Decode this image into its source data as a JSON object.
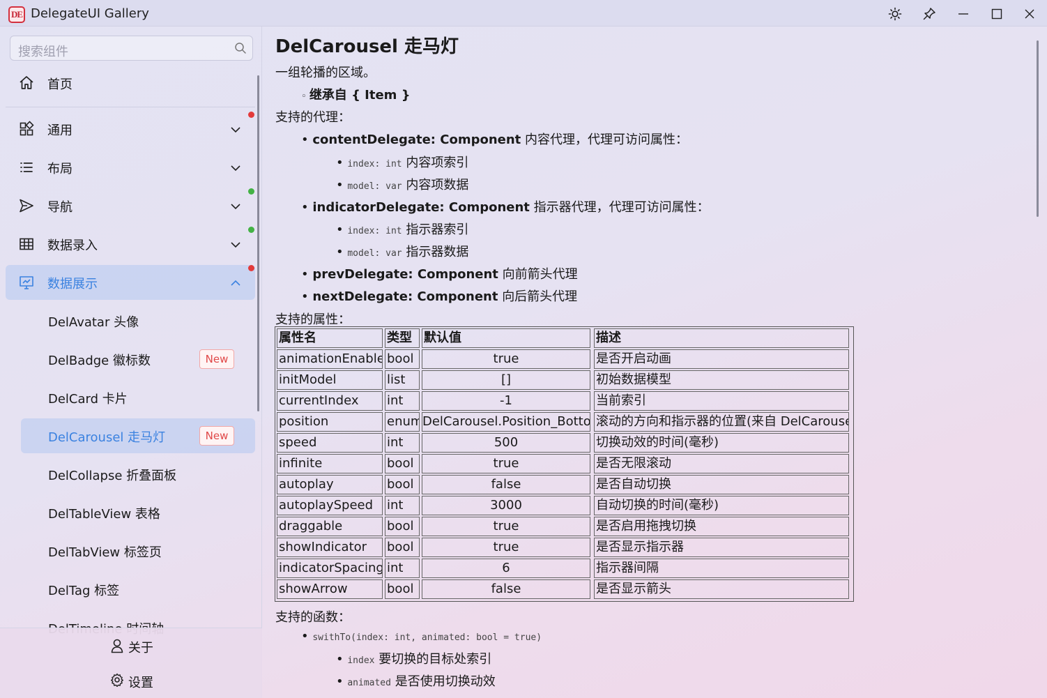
{
  "window": {
    "title": "DelegateUI Gallery",
    "logo_text": "DE"
  },
  "sidebar": {
    "search_placeholder": "搜索组件",
    "menu": [
      {
        "label": "首页",
        "icon": "home-icon"
      },
      {
        "label": "通用",
        "icon": "grid-icon"
      },
      {
        "label": "布局",
        "icon": "list-icon"
      },
      {
        "label": "导航",
        "icon": "send-icon"
      },
      {
        "label": "数据录入",
        "icon": "table-icon"
      },
      {
        "label": "数据展示",
        "icon": "presentation-icon"
      }
    ],
    "sub_items": [
      {
        "label": "DelAvatar 头像"
      },
      {
        "label": "DelBadge 徽标数",
        "badge": "New"
      },
      {
        "label": "DelCard 卡片"
      },
      {
        "label": "DelCarousel 走马灯",
        "badge": "New"
      },
      {
        "label": "DelCollapse 折叠面板"
      },
      {
        "label": "DelTableView 表格"
      },
      {
        "label": "DelTabView 标签页"
      },
      {
        "label": "DelTag 标签"
      },
      {
        "label": "DelTimeline 时间轴"
      }
    ],
    "footer": {
      "about": "关于",
      "settings": "设置"
    }
  },
  "doc": {
    "title": "DelCarousel 走马灯",
    "intro": "一组轮播的区域。",
    "inherits": "继承自 { Item }",
    "delegates_heading": "支持的代理：",
    "delegates": {
      "content": {
        "name": "contentDelegate: Component",
        "desc": "内容代理，代理可访问属性：",
        "p1_code": "index: int",
        "p1_desc": "内容项索引",
        "p2_code": "model: var",
        "p2_desc": "内容项数据"
      },
      "indicator": {
        "name": "indicatorDelegate: Component",
        "desc": "指示器代理，代理可访问属性：",
        "p1_code": "index: int",
        "p1_desc": "指示器索引",
        "p2_code": "model: var",
        "p2_desc": "指示器数据"
      },
      "prev": {
        "name": "prevDelegate: Component",
        "desc": "向前箭头代理"
      },
      "next": {
        "name": "nextDelegate: Component",
        "desc": "向后箭头代理"
      }
    },
    "props_heading": "支持的属性：",
    "table": {
      "headers": [
        "属性名",
        "类型",
        "默认值",
        "描述"
      ],
      "rows": [
        [
          "animationEnabled",
          "bool",
          "true",
          "是否开启动画"
        ],
        [
          "initModel",
          "list",
          "[]",
          "初始数据模型"
        ],
        [
          "currentIndex",
          "int",
          "-1",
          "当前索引"
        ],
        [
          "position",
          "enum",
          "DelCarousel.Position_Bottom",
          "滚动的方向和指示器的位置(来自 DelCarousel)"
        ],
        [
          "speed",
          "int",
          "500",
          "切换动效的时间(毫秒)"
        ],
        [
          "infinite",
          "bool",
          "true",
          "是否无限滚动"
        ],
        [
          "autoplay",
          "bool",
          "false",
          "是否自动切换"
        ],
        [
          "autoplaySpeed",
          "int",
          "3000",
          "自动切换的时间(毫秒)"
        ],
        [
          "draggable",
          "bool",
          "true",
          "是否启用拖拽切换"
        ],
        [
          "showIndicator",
          "bool",
          "true",
          "是否显示指示器"
        ],
        [
          "indicatorSpacing",
          "int",
          "6",
          "指示器间隔"
        ],
        [
          "showArrow",
          "bool",
          "false",
          "是否显示箭头"
        ]
      ]
    },
    "funcs_heading": "支持的函数：",
    "func": {
      "signature": "swithTo(index: int, animated: bool = true)",
      "a1_code": "index",
      "a1_desc": "要切换的目标处索引",
      "a2_code": "animated",
      "a2_desc": "是否使用切换动效"
    }
  }
}
